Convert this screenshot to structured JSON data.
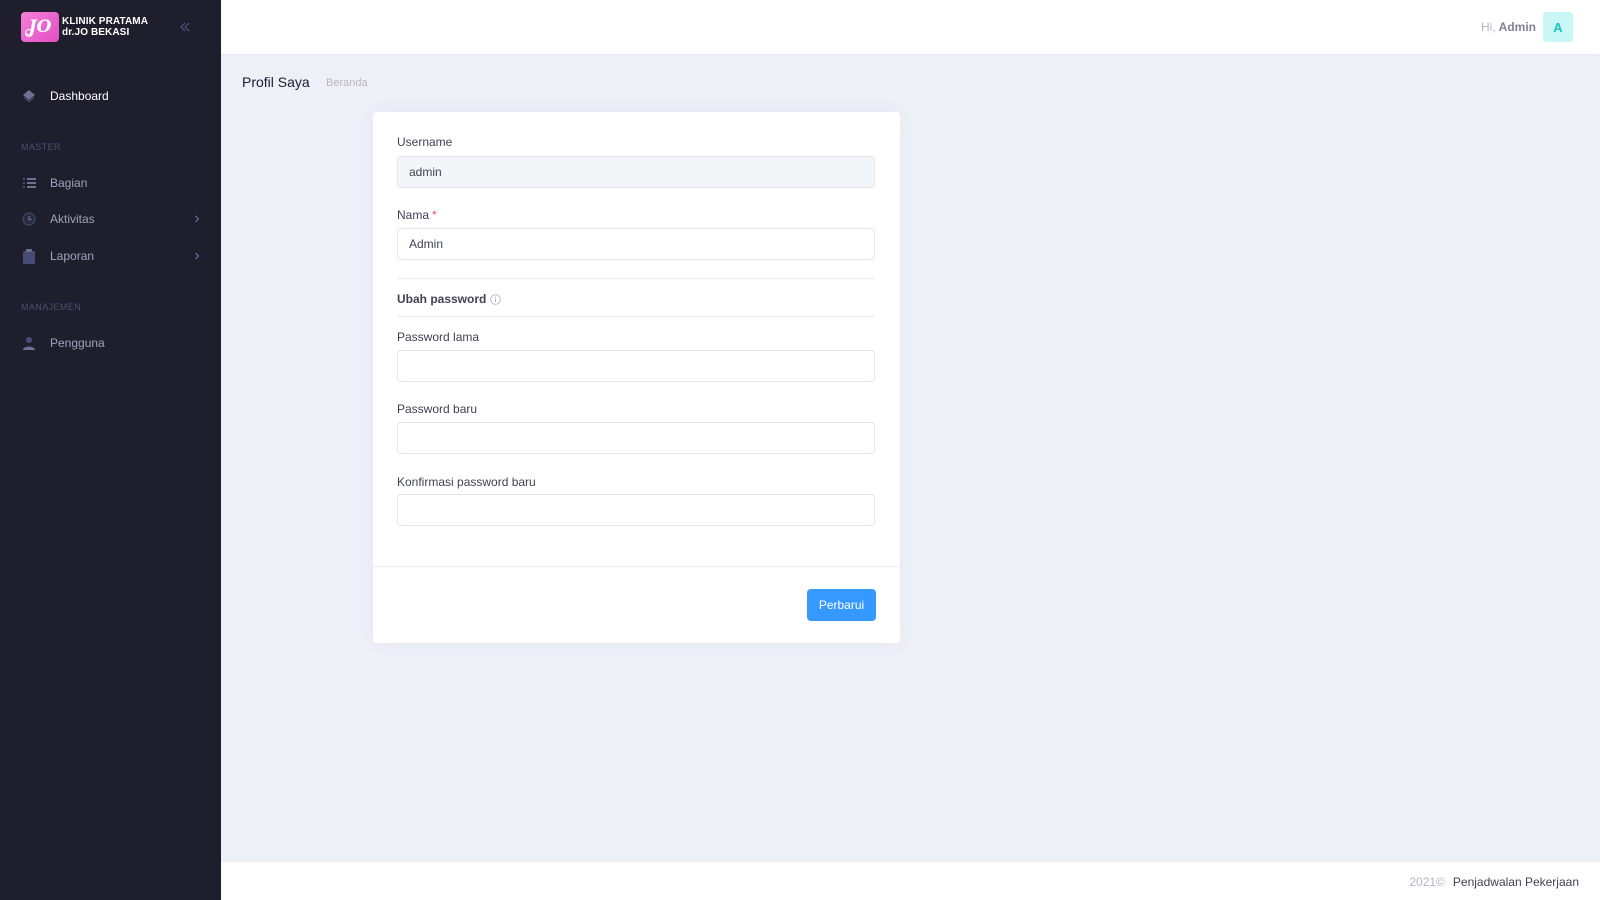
{
  "brand": {
    "logo_text": "JO",
    "line1": "KLINIK PRATAMA",
    "line2": "dr.JO BEKASI"
  },
  "sidebar": {
    "items": [
      {
        "label": "Dashboard",
        "icon": "layers-icon"
      },
      {
        "label": "Bagian",
        "icon": "list-icon"
      },
      {
        "label": "Aktivitas",
        "icon": "clock-icon"
      },
      {
        "label": "Laporan",
        "icon": "clipboard-icon"
      },
      {
        "label": "Pengguna",
        "icon": "user-icon"
      }
    ],
    "sections": [
      "MASTER",
      "MANAJEMEN"
    ]
  },
  "header": {
    "greeting": "Hi,",
    "user_name": "Admin",
    "avatar_letter": "A"
  },
  "subheader": {
    "title": "Profil Saya",
    "breadcrumb": "Beranda"
  },
  "form": {
    "username_label": "Username",
    "username_value": "admin",
    "nama_label": "Nama",
    "nama_required": "*",
    "nama_value": "Admin",
    "password_section": "Ubah password",
    "old_password_label": "Password lama",
    "new_password_label": "Password baru",
    "confirm_password_label": "Konfirmasi password baru",
    "submit_label": "Perbarui"
  },
  "footer": {
    "year": "2021©",
    "app_name": "Penjadwalan Pekerjaan"
  },
  "colors": {
    "sidebar_bg": "#1e1e2d",
    "page_bg": "#eef0f8",
    "primary": "#3699ff",
    "brand_pink": "#e34fc4",
    "avatar_bg": "#c9f7f5",
    "avatar_fg": "#1bc5bd"
  }
}
